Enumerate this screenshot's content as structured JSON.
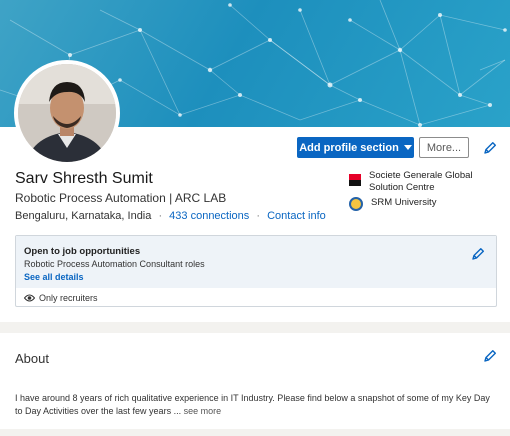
{
  "profile": {
    "name": "Sarv Shresth Sumit",
    "headline": "Robotic Process Automation | ARC LAB",
    "location": "Bengaluru, Karnataka, India",
    "connections": "433 connections",
    "contact": "Contact info",
    "separator": "·"
  },
  "actions": {
    "add_section": "Add profile section",
    "more": "More..."
  },
  "orgs": [
    {
      "name": "Societe Generale Global Solution Centre",
      "icon": "societe-generale-logo"
    },
    {
      "name": "SRM University",
      "icon": "srm-university-logo"
    }
  ],
  "job": {
    "title": "Open to job opportunities",
    "roles": "Robotic Process Automation Consultant roles",
    "link": "See all details",
    "visibility": "Only recruiters"
  },
  "about": {
    "title": "About",
    "text": "I have around 8 years of rich qualitative experience in IT Industry. Please find below a snapshot of some of my Key Day to Day Activities over the last few years ...",
    "see_more": "see more"
  },
  "colors": {
    "accent": "#0a66c2",
    "banner": "#1d8fbd",
    "job_bg": "#eef3f8"
  }
}
